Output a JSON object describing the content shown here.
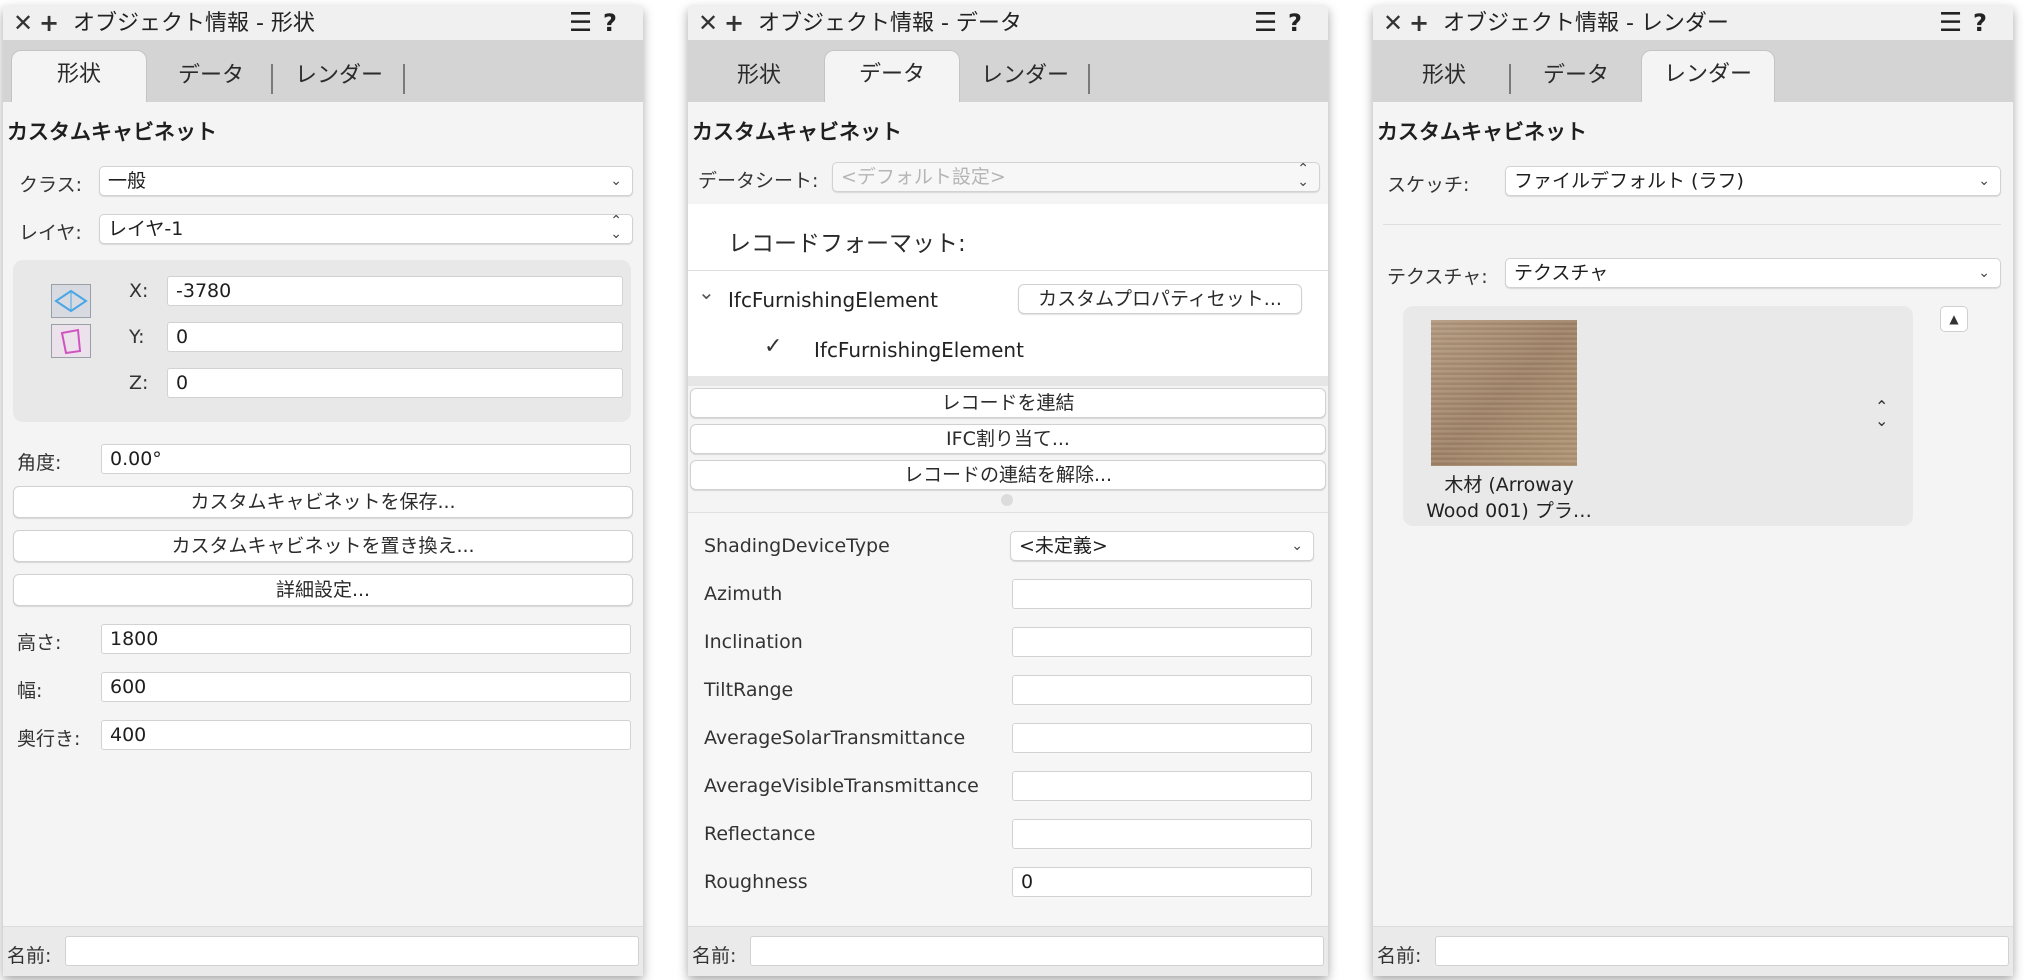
{
  "tabs": [
    "形状",
    "データ",
    "レンダー"
  ],
  "object_name": "カスタムキャビネット",
  "panels": {
    "shape": {
      "title": "オブジェクト情報 - 形状",
      "class_label": "クラス:",
      "class_value": "一般",
      "layer_label": "レイヤ:",
      "layer_value": "レイヤ-1",
      "x_label": "X:",
      "x_value": "-3780",
      "y_label": "Y:",
      "y_value": "0",
      "z_label": "Z:",
      "z_value": "0",
      "angle_label": "角度:",
      "angle_value": "0.00°",
      "save_button": "カスタムキャビネットを保存...",
      "replace_button": "カスタムキャビネットを置き換え...",
      "detail_button": "詳細設定...",
      "height_label": "高さ:",
      "height_value": "1800",
      "width_label": "幅:",
      "width_value": "600",
      "depth_label": "奥行き:",
      "depth_value": "400"
    },
    "data": {
      "title": "オブジェクト情報 - データ",
      "datasheet_label": "データシート:",
      "datasheet_value": "<デフォルト設定>",
      "record_format_label": "レコードフォーマット:",
      "record_name": "IfcFurnishingElement",
      "custom_pset_button": "カスタムプロパティセット...",
      "record_child": "IfcFurnishingElement",
      "attach_record_button": "レコードを連結",
      "ifc_assign_button": "IFC割り当て...",
      "detach_record_button": "レコードの連結を解除...",
      "properties": [
        {
          "name": "ShadingDeviceType",
          "value": "<未定義>",
          "popup": true
        },
        {
          "name": "Azimuth",
          "value": ""
        },
        {
          "name": "Inclination",
          "value": ""
        },
        {
          "name": "TiltRange",
          "value": ""
        },
        {
          "name": "AverageSolarTransmittance",
          "value": ""
        },
        {
          "name": "AverageVisibleTransmittance",
          "value": ""
        },
        {
          "name": "Reflectance",
          "value": ""
        },
        {
          "name": "Roughness",
          "value": "0"
        }
      ]
    },
    "render": {
      "title": "オブジェクト情報 - レンダー",
      "sketch_label": "スケッチ:",
      "sketch_value": "ファイルデフォルト (ラフ)",
      "texture_label": "テクスチャ:",
      "texture_value": "テクスチャ",
      "texture_name_line1": "木材 (Arroway",
      "texture_name_line2": "Wood 001) プラ…"
    }
  },
  "footer": {
    "name_label": "名前:",
    "name_value": ""
  },
  "icons": {
    "close": "✕",
    "add": "+",
    "menu": "☰",
    "help": "?",
    "chevron": "⌄",
    "checkmark": "✓",
    "disclosure": "⌄"
  },
  "colors": {
    "panel_bg": "#f4f4f4",
    "tab_bar": "#d4d4d4",
    "field_bg": "#ffffff"
  }
}
